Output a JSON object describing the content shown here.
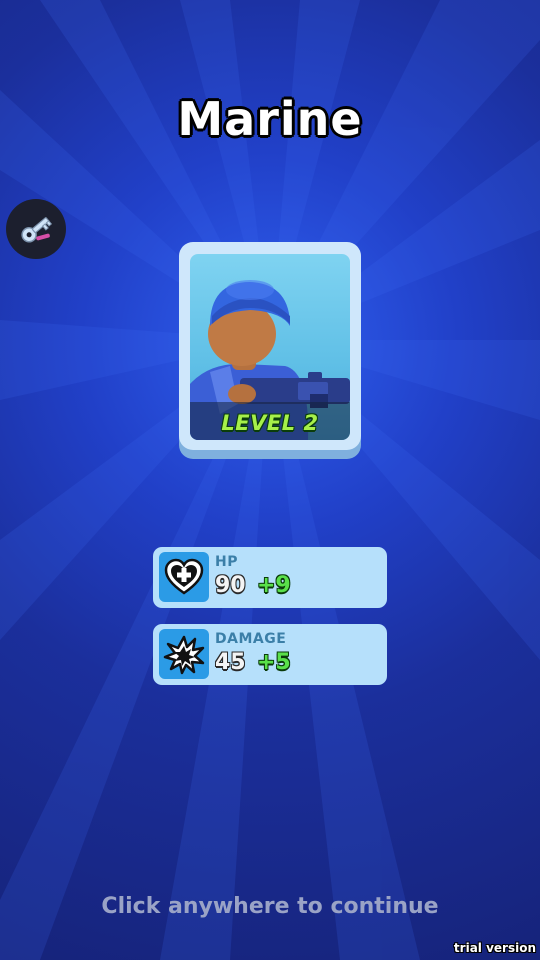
{
  "character": {
    "name": "Marine",
    "level_label": "LEVEL 2"
  },
  "stats": [
    {
      "label": "HP",
      "value": "90",
      "bonus": "+9",
      "icon": "heart-plus-icon"
    },
    {
      "label": "DAMAGE",
      "value": "45",
      "bonus": "+5",
      "icon": "explosion-icon"
    }
  ],
  "key_button": {
    "icon": "key-icon"
  },
  "prompt": "Click anywhere to continue",
  "watermark": "trial version",
  "colors": {
    "background": "#1b2f9c",
    "card": "#cfe7fb",
    "stat_panel": "#b6e0fb",
    "stat_icon_bg": "#2b9be6",
    "level_text": "#a6f04a",
    "bonus_text": "#5ae04a"
  }
}
